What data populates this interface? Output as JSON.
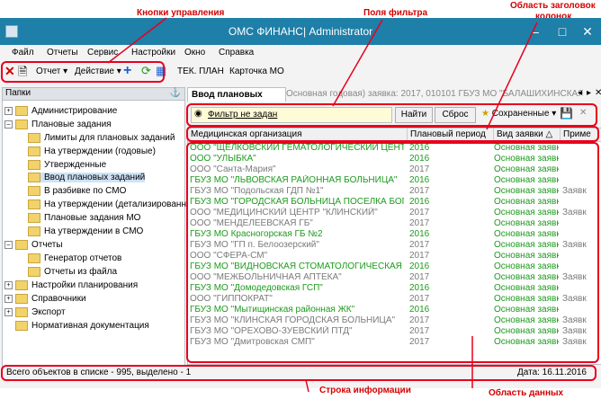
{
  "annotations": {
    "controls": "Кнопки управления",
    "filters": "Поля фильтра",
    "column_headers_l1": "Область заголовок",
    "column_headers_l2": "колонок",
    "info_line": "Строка информации",
    "data_area": "Область данных"
  },
  "window": {
    "title": "ОМС ФИНАНС| Administrator"
  },
  "menu": [
    "Файл",
    "Отчеты",
    "Сервис",
    "Настройки",
    "Окно",
    "Справка"
  ],
  "toolbar": {
    "report": "Отчет",
    "action": "Действие",
    "plan": "ТЕК. ПЛАН",
    "card": "Карточка МО"
  },
  "folders_panel": {
    "title": "Папки",
    "items": [
      "Администрирование",
      "Плановые задания",
      "Лимиты для плановых заданий",
      "На утверждении (годовые)",
      "Утвержденные",
      "Ввод плановых заданий",
      "В разбивке по СМО",
      "На утверждении (детализированные)",
      "Плановые задания МО",
      "На утверждении в СМО",
      "Отчеты",
      "Генератор отчетов",
      "Отчеты из файла",
      "Настройки планирования",
      "Справочники",
      "Экспорт",
      "Нормативная документация"
    ]
  },
  "tabs": {
    "active": "Ввод плановых заданий",
    "inactive": "Основная годовая) заявка: 2017, 010101 ГБУЗ МО \"БАЛАШИХИНСКАЯ ЦР"
  },
  "filter": {
    "value": "Фильтр не задан",
    "find": "Найти",
    "reset": "Сброс",
    "saved": "Сохраненные"
  },
  "grid": {
    "columns": [
      "Медицинская организация",
      "Плановый период",
      "Вид заявки",
      "Приме"
    ],
    "rows": [
      {
        "org": "ООО \"ЩЕЛКОВСКИЙ ГЕМАТОЛОГИЧЕСКИЙ ЦЕНТР\"",
        "year": "2016",
        "type": "Основная заявка",
        "note": ""
      },
      {
        "org": "ООО \"УЛЫБКА\"",
        "year": "2016",
        "type": "Основная заявка",
        "note": ""
      },
      {
        "org": "ООО \"Санта-Мария\"",
        "year": "2017",
        "type": "Основная заявка",
        "note": ""
      },
      {
        "org": "ГБУЗ МО \"ЛЬВОВСКАЯ РАЙОННАЯ БОЛЬНИЦА\"",
        "year": "2016",
        "type": "Основная заявка",
        "note": ""
      },
      {
        "org": "ГБУЗ МО \"Подольская ГДП №1\"",
        "year": "2017",
        "type": "Основная заявка",
        "note": "Заявк"
      },
      {
        "org": "ГБУЗ МО \"ГОРОДСКАЯ БОЛЬНИЦА ПОСЕЛКА БОГОРО...",
        "year": "2016",
        "type": "Основная заявка",
        "note": ""
      },
      {
        "org": "ООО \"МЕДИЦИНСКИЙ ЦЕНТР \"КЛИНСКИЙ\"",
        "year": "2017",
        "type": "Основная заявка",
        "note": "Заявк"
      },
      {
        "org": "ООО \"МЕНДЕЛЕЕВСКАЯ ГБ\"",
        "year": "2017",
        "type": "Основная заявка",
        "note": ""
      },
      {
        "org": "ГБУЗ МО Красногорская ГБ №2",
        "year": "2016",
        "type": "Основная заявка",
        "note": ""
      },
      {
        "org": "ГБУЗ МО \"ГП п. Белоозерский\"",
        "year": "2017",
        "type": "Основная заявка",
        "note": "Заявк"
      },
      {
        "org": "ООО \"СФЕРА-СМ\"",
        "year": "2017",
        "type": "Основная заявка",
        "note": ""
      },
      {
        "org": "ГБУЗ МО \"ВИДНОВСКАЯ СТОМАТОЛОГИЧЕСКАЯ ПОЛ...",
        "year": "2016",
        "type": "Основная заявка",
        "note": ""
      },
      {
        "org": "ООО \"МЕЖБОЛЬНИЧНАЯ АПТЕКА\"",
        "year": "2017",
        "type": "Основная заявка",
        "note": "Заявк"
      },
      {
        "org": "ГБУЗ МО \"Домодедовская ГСП\"",
        "year": "2016",
        "type": "Основная заявка",
        "note": ""
      },
      {
        "org": "ООО \"ГИППОКРАТ\"",
        "year": "2017",
        "type": "Основная заявка",
        "note": "Заявк"
      },
      {
        "org": "ГБУЗ МО \"Мытищинская районная ЖК\"",
        "year": "2016",
        "type": "Основная заявка",
        "note": ""
      },
      {
        "org": "ГБУЗ МО \"КЛИНСКАЯ ГОРОДСКАЯ БОЛЬНИЦА\"",
        "year": "2017",
        "type": "Основная заявка",
        "note": "Заявк"
      },
      {
        "org": "ГБУЗ МО \"ОРЕХОВО-ЗУЕВСКИЙ ПТД\"",
        "year": "2017",
        "type": "Основная заявка",
        "note": "Заявк"
      },
      {
        "org": "ГБУЗ МО \"Дмитровская СМП\"",
        "year": "2017",
        "type": "Основная заявка",
        "note": "Заявк"
      }
    ]
  },
  "status": {
    "left": "Всего объектов в списке - 995, выделено - 1",
    "right": "Дата: 16.11.2016"
  },
  "colors": {
    "accent_red": "#e8001c",
    "green_text": "#1d9a1d",
    "gray_text": "#7a7a7a",
    "titlebar": "#1e7fa8"
  }
}
